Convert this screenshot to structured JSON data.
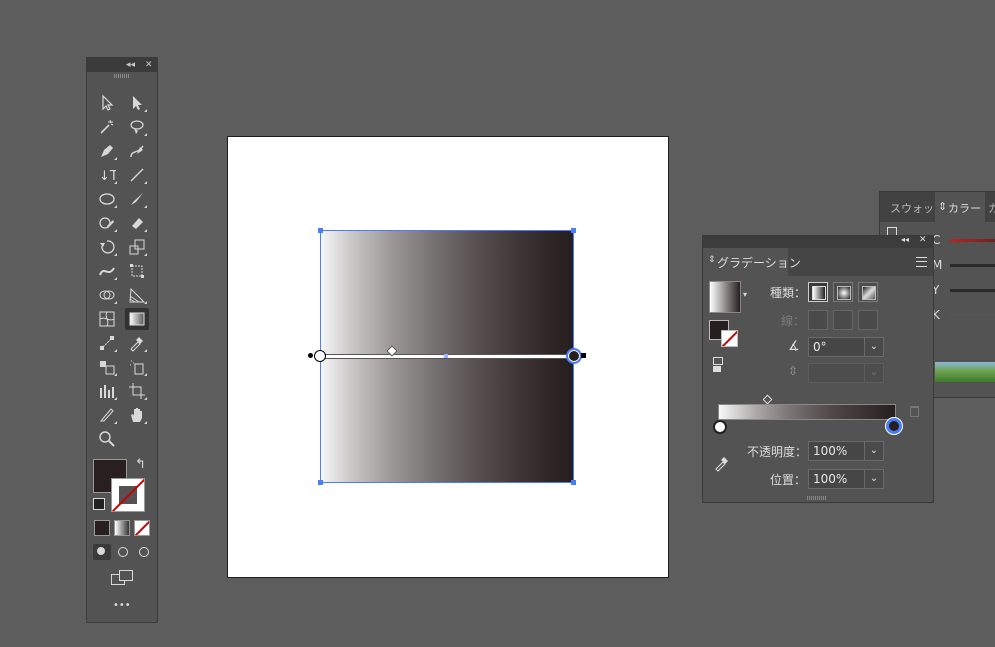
{
  "toolbar": {
    "collapse_glyph": "◂◂",
    "close_glyph": "✕",
    "more_label": "•••",
    "tools": [
      {
        "name": "selection-tool-icon"
      },
      {
        "name": "direct-selection-tool-icon"
      },
      {
        "name": "magic-wand-tool-icon"
      },
      {
        "name": "lasso-tool-icon"
      },
      {
        "name": "pen-tool-icon"
      },
      {
        "name": "curvature-tool-icon"
      },
      {
        "name": "type-tool-icon"
      },
      {
        "name": "line-segment-tool-icon"
      },
      {
        "name": "ellipse-tool-icon"
      },
      {
        "name": "paintbrush-tool-icon"
      },
      {
        "name": "shaper-tool-icon"
      },
      {
        "name": "eraser-tool-icon"
      },
      {
        "name": "rotate-tool-icon"
      },
      {
        "name": "scale-tool-icon"
      },
      {
        "name": "width-tool-icon"
      },
      {
        "name": "free-transform-tool-icon"
      },
      {
        "name": "shape-builder-tool-icon"
      },
      {
        "name": "perspective-grid-tool-icon"
      },
      {
        "name": "mesh-tool-icon"
      },
      {
        "name": "gradient-tool-icon"
      },
      {
        "name": "blend-tool-icon"
      },
      {
        "name": "eyedropper-tool-icon"
      },
      {
        "name": "live-paint-bucket-tool-icon"
      },
      {
        "name": "symbol-sprayer-tool-icon"
      },
      {
        "name": "column-graph-tool-icon"
      },
      {
        "name": "artboard-tool-icon"
      },
      {
        "name": "slice-tool-icon"
      },
      {
        "name": "hand-tool-icon"
      },
      {
        "name": "zoom-tool-icon"
      }
    ],
    "fill_color": "#2a1f1f",
    "stroke": "none"
  },
  "color_panel": {
    "tab_swatches": "スウォッチ",
    "tab_color": "カラー",
    "tab_next": "カ",
    "channels": [
      "C",
      "M",
      "Y",
      "K"
    ]
  },
  "gradient_panel": {
    "tab_label": "グラデーション",
    "collapse_glyph": "◂◂",
    "close_glyph": "✕",
    "type_label": "種類：",
    "stroke_label": "線：",
    "angle_value": "0°",
    "aspect_value": "",
    "opacity_label": "不透明度：",
    "opacity_value": "100%",
    "location_label": "位置：",
    "location_value": "100%",
    "start_color": "#ffffff",
    "end_color": "#271f1f"
  },
  "canvas": {
    "artboard_color": "#ffffff",
    "gradient_start": "#f8f8f8",
    "gradient_end": "#271f1f",
    "selection_color": "#4a7df6"
  }
}
